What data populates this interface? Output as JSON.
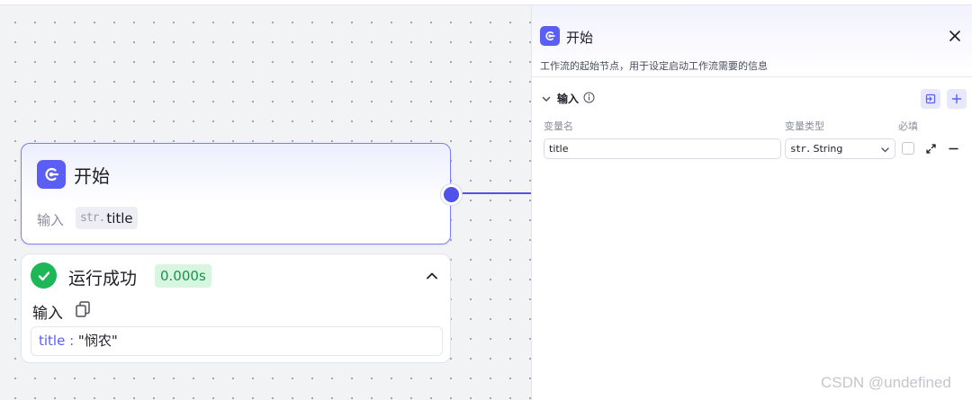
{
  "start_node": {
    "title": "开始",
    "input_label": "输入",
    "input_chip": {
      "type": "str.",
      "name": "title"
    }
  },
  "run_result": {
    "status": "运行成功",
    "duration": "0.000s",
    "input_label": "输入",
    "input_value": {
      "key": "title : ",
      "value": "\"悯农\""
    }
  },
  "panel": {
    "title": "开始",
    "description": "工作流的起始节点，用于设定启动工作流需要的信息",
    "section_title": "输入",
    "columns": {
      "name": "变量名",
      "type": "变量类型",
      "required": "必填"
    },
    "variables": [
      {
        "name": "title",
        "type_prefix": "str.",
        "type_label": "String",
        "required": false
      }
    ]
  },
  "watermark": "CSDN @undefined",
  "colors": {
    "accent": "#5b5ef4",
    "edge": "#4f53ea",
    "success": "#1db757",
    "success_bg": "#d7f5e1",
    "canvas_bg": "#f2f3f5"
  },
  "icons": {
    "node": "start-node-icon",
    "status": "check-circle-icon",
    "collapse": "chevron-up-icon",
    "copy": "copy-icon",
    "close": "close-icon",
    "section": "chevron-down-icon",
    "info": "info-icon",
    "import": "import-icon",
    "add": "plus-icon",
    "expand": "expand-icon",
    "remove": "minus-icon"
  }
}
